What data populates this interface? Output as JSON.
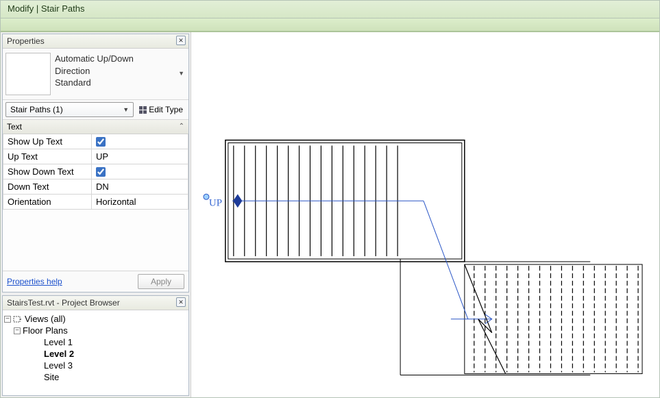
{
  "ribbon": {
    "tab_label": "Modify | Stair Paths"
  },
  "properties": {
    "panel_title": "Properties",
    "type_line1": "Automatic Up/Down",
    "type_line2": "Direction",
    "type_line3": "Standard",
    "family_selector": "Stair Paths (1)",
    "edit_type_label": "Edit Type",
    "category_text": "Text",
    "rows": {
      "show_up_label": "Show Up Text",
      "up_text_label": "Up Text",
      "up_text_value": "UP",
      "show_down_label": "Show Down Text",
      "down_text_label": "Down Text",
      "down_text_value": "DN",
      "orientation_label": "Orientation",
      "orientation_value": "Horizontal"
    },
    "help_link": "Properties help",
    "apply_label": "Apply"
  },
  "browser": {
    "panel_title": "StairsTest.rvt - Project Browser",
    "views_label": "Views (all)",
    "floor_plans_label": "Floor Plans",
    "levels": {
      "l1": "Level 1",
      "l2": "Level 2",
      "l3": "Level 3",
      "site": "Site"
    }
  },
  "canvas": {
    "path_text": "UP"
  }
}
